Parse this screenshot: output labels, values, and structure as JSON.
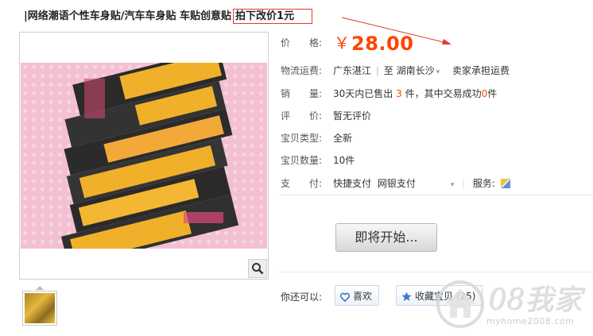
{
  "title": {
    "main": "|网络潮语个性车身贴/汽车车身贴 车贴创意贴",
    "highlight": "拍下改价1元"
  },
  "price": {
    "label": "价　　格:",
    "currency": "￥",
    "value": "28.00"
  },
  "shipping": {
    "label": "物流运费:",
    "from": "广东湛江",
    "separator": "|",
    "to_prefix": "至",
    "to": "湖南长沙",
    "note": "卖家承担运费"
  },
  "sales": {
    "label": "销　　量:",
    "text_a": "30天内已售出",
    "sold": "3",
    "text_b": "件，其中交易成功",
    "success": "0",
    "text_c": "件"
  },
  "rating": {
    "label": "评　　价:",
    "value": "暂无评价"
  },
  "item_type": {
    "label": "宝贝类型:",
    "value": "全新"
  },
  "quantity": {
    "label": "宝贝数量:",
    "value": "10件"
  },
  "payment": {
    "label": "支　　付:",
    "methods": [
      "快捷支付",
      "网银支付"
    ],
    "service_label": "服务:"
  },
  "actions": {
    "buy_label": "即将开始...",
    "you_can": "你还可以:",
    "like_label": "喜欢",
    "collect_label": "收藏宝贝 (25)"
  },
  "watermark": {
    "big": "08我家",
    "small": "myhome2008.com"
  },
  "colors": {
    "price": "#ff4400",
    "highlight_border": "#e23a2a",
    "icon_blue": "#3d78c3"
  }
}
